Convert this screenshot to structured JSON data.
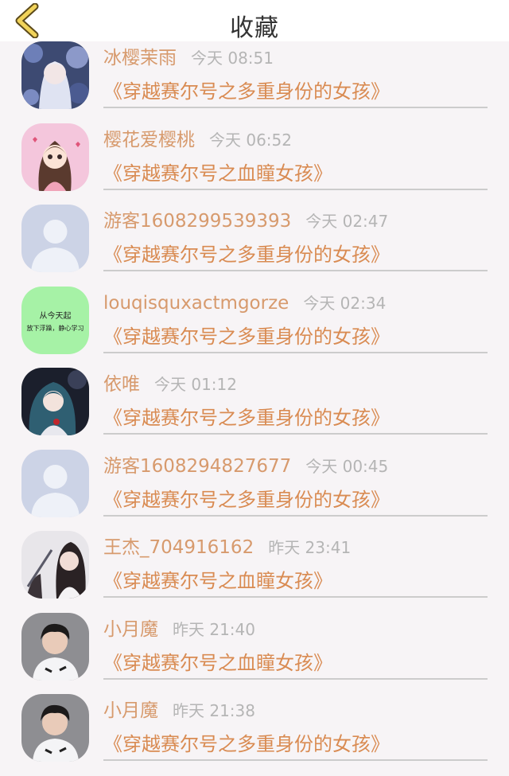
{
  "header": {
    "title": "收藏",
    "back_icon": "chevron-left-icon",
    "back_color": "#f1d35a"
  },
  "accent": {
    "username": "#d79a6d",
    "book_title": "#d98b52",
    "time": "#b5b5b5"
  },
  "items": [
    {
      "user": "冰樱茉雨",
      "time": "今天 08:51",
      "book": "《穿越赛尔号之多重身份的女孩》",
      "avatar": "anime-girl-flowers"
    },
    {
      "user": "樱花爱樱桃",
      "time": "今天 06:52",
      "book": "《穿越赛尔号之血瞳女孩》",
      "avatar": "cartoon-girl-pink"
    },
    {
      "user": "游客1608299539393",
      "time": "今天 02:47",
      "book": "《穿越赛尔号之多重身份的女孩》",
      "avatar": "default-person"
    },
    {
      "user": "louqisquxactmgorze",
      "time": "今天 02:34",
      "book": "《穿越赛尔号之多重身份的女孩》",
      "avatar": "green-text-card",
      "avatar_text": [
        "从今天起",
        "放下浮躁，静心学习"
      ]
    },
    {
      "user": "依唯",
      "time": "今天 01:12",
      "book": "《穿越赛尔号之多重身份的女孩》",
      "avatar": "anime-girl-dark"
    },
    {
      "user": "游客1608294827677",
      "time": "今天 00:45",
      "book": "《穿越赛尔号之多重身份的女孩》",
      "avatar": "default-person"
    },
    {
      "user": "王杰_704916162",
      "time": "昨天 23:41",
      "book": "《穿越赛尔号之血瞳女孩》",
      "avatar": "illustration-woman"
    },
    {
      "user": "小月魔",
      "time": "昨天 21:40",
      "book": "《穿越赛尔号之血瞳女孩》",
      "avatar": "photo-boy"
    },
    {
      "user": "小月魔",
      "time": "昨天 21:38",
      "book": "《穿越赛尔号之多重身份的女孩》",
      "avatar": "photo-boy"
    }
  ]
}
